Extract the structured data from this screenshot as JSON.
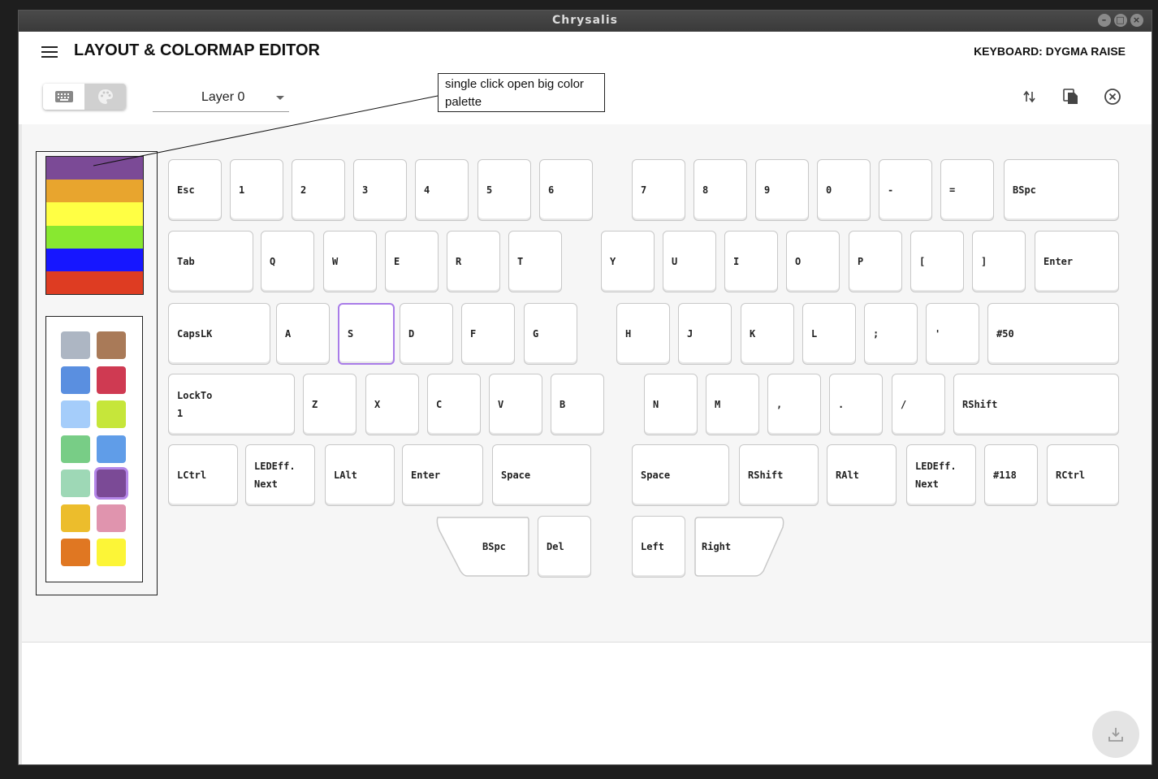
{
  "window": {
    "title": "Chrysalis"
  },
  "header": {
    "title": "LAYOUT & COLORMAP EDITOR",
    "keyboard_label": "KEYBOARD: DYGMA RAISE"
  },
  "toolbar": {
    "layer_value": "Layer 0"
  },
  "callout": {
    "text": "single click open big color palette"
  },
  "big_palette": [
    "#7b4a96",
    "#e8a52e",
    "#ffff44",
    "#88e830",
    "#1616ff",
    "#de3c22"
  ],
  "swatches": [
    "#adb6c3",
    "#a97a58",
    "#5a8fe0",
    "#cf3a52",
    "#a5cdfa",
    "#c6e63a",
    "#78cd86",
    "#609de8",
    "#9ed8b6",
    "#7b4a96",
    "#ecbd2c",
    "#e094ae",
    "#e07722",
    "#fcf537"
  ],
  "selected_swatch": 9,
  "keys": [
    {
      "label": "Esc"
    },
    {
      "label": "1"
    },
    {
      "label": "2"
    },
    {
      "label": "3"
    },
    {
      "label": "4"
    },
    {
      "label": "5"
    },
    {
      "label": "6"
    },
    {
      "label": "7"
    },
    {
      "label": "8"
    },
    {
      "label": "9"
    },
    {
      "label": "0"
    },
    {
      "label": "-"
    },
    {
      "label": "="
    },
    {
      "label": "BSpc"
    },
    {
      "label": "Tab"
    },
    {
      "label": "Q"
    },
    {
      "label": "W"
    },
    {
      "label": "E"
    },
    {
      "label": "R"
    },
    {
      "label": "T"
    },
    {
      "label": "Y"
    },
    {
      "label": "U"
    },
    {
      "label": "I"
    },
    {
      "label": "O"
    },
    {
      "label": "P"
    },
    {
      "label": "["
    },
    {
      "label": "]"
    },
    {
      "label": "Enter"
    },
    {
      "label": "CapsLK"
    },
    {
      "label": "A"
    },
    {
      "label": "S"
    },
    {
      "label": "D"
    },
    {
      "label": "F"
    },
    {
      "label": "G"
    },
    {
      "label": "H"
    },
    {
      "label": "J"
    },
    {
      "label": "K"
    },
    {
      "label": "L"
    },
    {
      "label": ";"
    },
    {
      "label": "'"
    },
    {
      "label": "#50"
    },
    {
      "label": "LockTo\n1"
    },
    {
      "label": "Z"
    },
    {
      "label": "X"
    },
    {
      "label": "C"
    },
    {
      "label": "V"
    },
    {
      "label": "B"
    },
    {
      "label": "N"
    },
    {
      "label": "M"
    },
    {
      "label": ","
    },
    {
      "label": "."
    },
    {
      "label": "/"
    },
    {
      "label": "RShift"
    },
    {
      "label": "LCtrl"
    },
    {
      "label": "LEDEff.\nNext"
    },
    {
      "label": "LAlt"
    },
    {
      "label": "Enter"
    },
    {
      "label": "Space"
    },
    {
      "label": "Space"
    },
    {
      "label": "RShift"
    },
    {
      "label": "RAlt"
    },
    {
      "label": "LEDEff.\nNext"
    },
    {
      "label": "#118"
    },
    {
      "label": "RCtrl"
    },
    {
      "label": "BSpc"
    },
    {
      "label": "Del"
    },
    {
      "label": "Left"
    },
    {
      "label": "Right"
    }
  ],
  "selected_key": 30,
  "icons": {
    "menu": "menu-icon",
    "keyboard": "keyboard-icon",
    "palette": "palette-icon",
    "swap": "swap-vert-icon",
    "copy": "copy-icon",
    "close": "close-circle-icon",
    "download": "download-icon"
  }
}
